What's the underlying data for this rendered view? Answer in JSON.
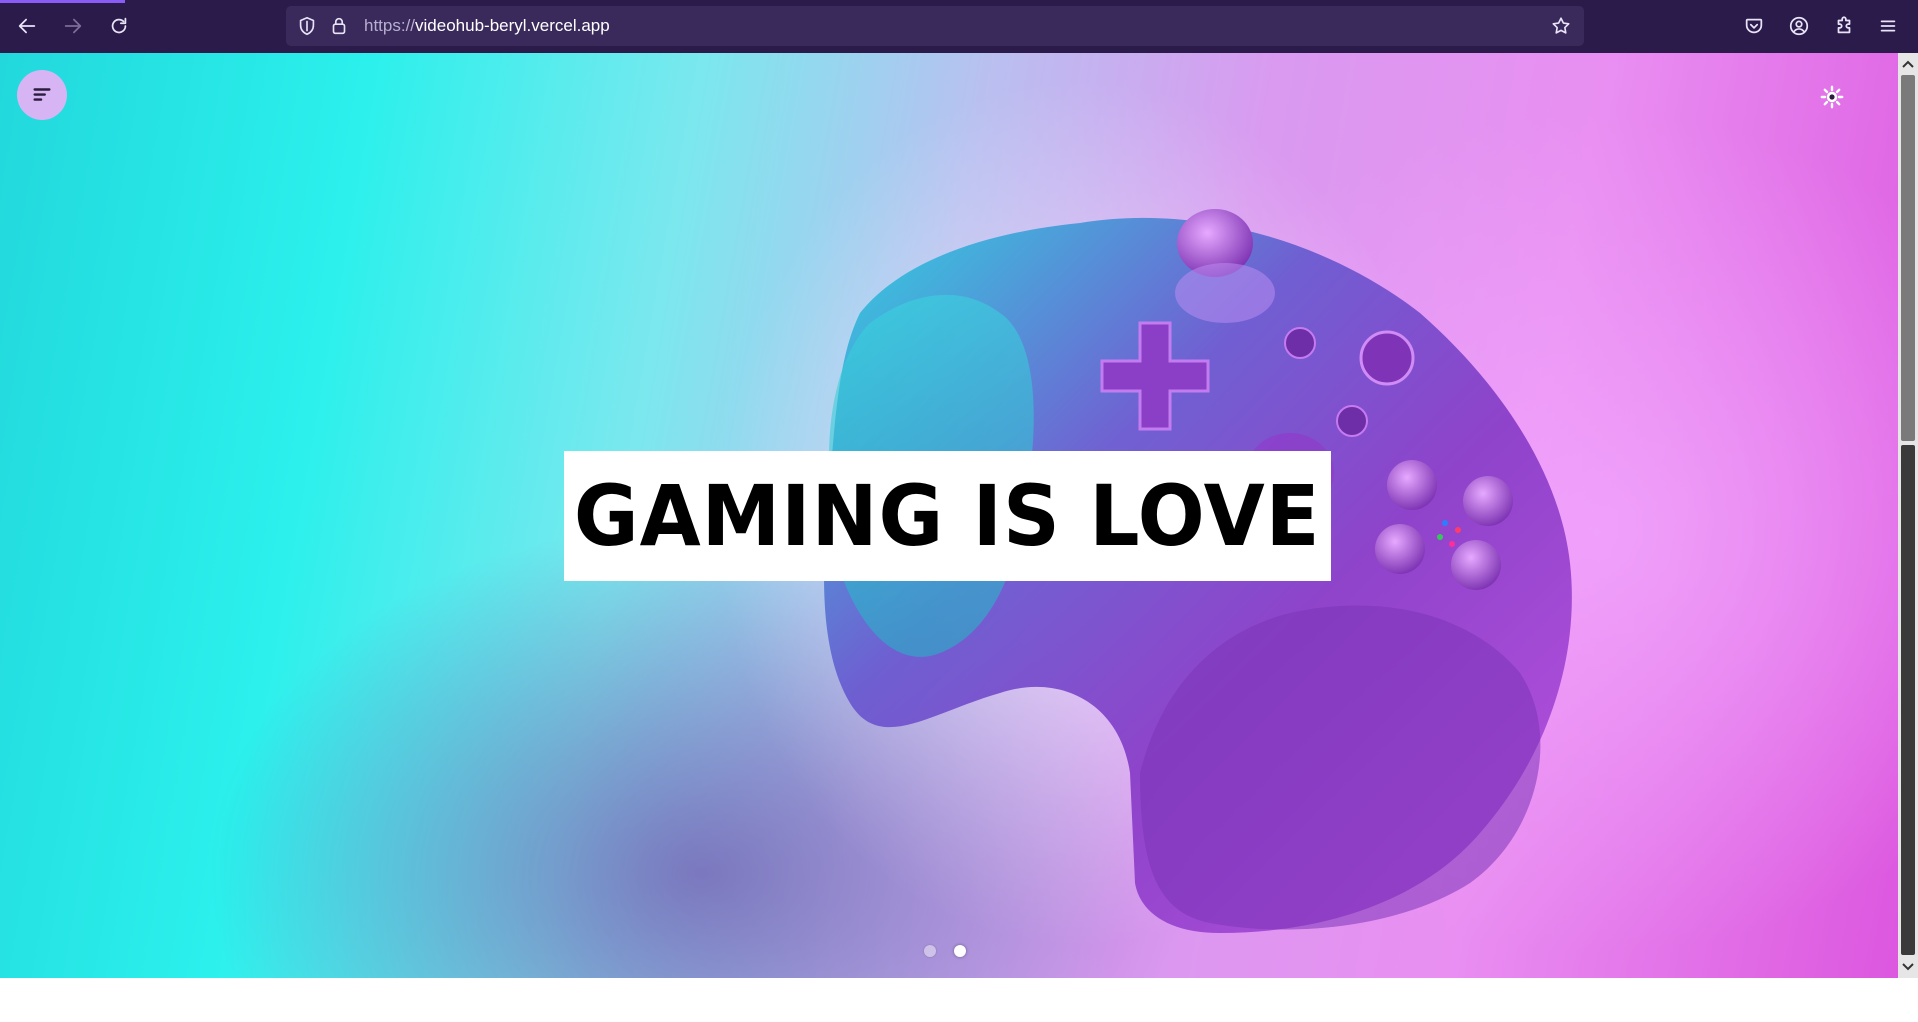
{
  "browser": {
    "url_scheme": "https://",
    "url_host": "videohub-beryl.vercel.app",
    "toolbar_icons": [
      "back-icon",
      "forward-icon",
      "reload-icon",
      "shield-icon",
      "lock-icon",
      "bookmark-star-icon",
      "pocket-icon",
      "account-icon",
      "extensions-icon",
      "menu-icon"
    ],
    "accent": "#8a5cf6",
    "toolbar_bg": "#2b1b4a"
  },
  "page": {
    "menu_icon": "sort-menu-icon",
    "theme_icon": "sun-icon",
    "hero": {
      "title": "GAMING IS LOVE",
      "image": "purple-game-controller-on-cyan-magenta-background"
    },
    "carousel": {
      "slide_count": 2,
      "active_index": 1
    }
  }
}
